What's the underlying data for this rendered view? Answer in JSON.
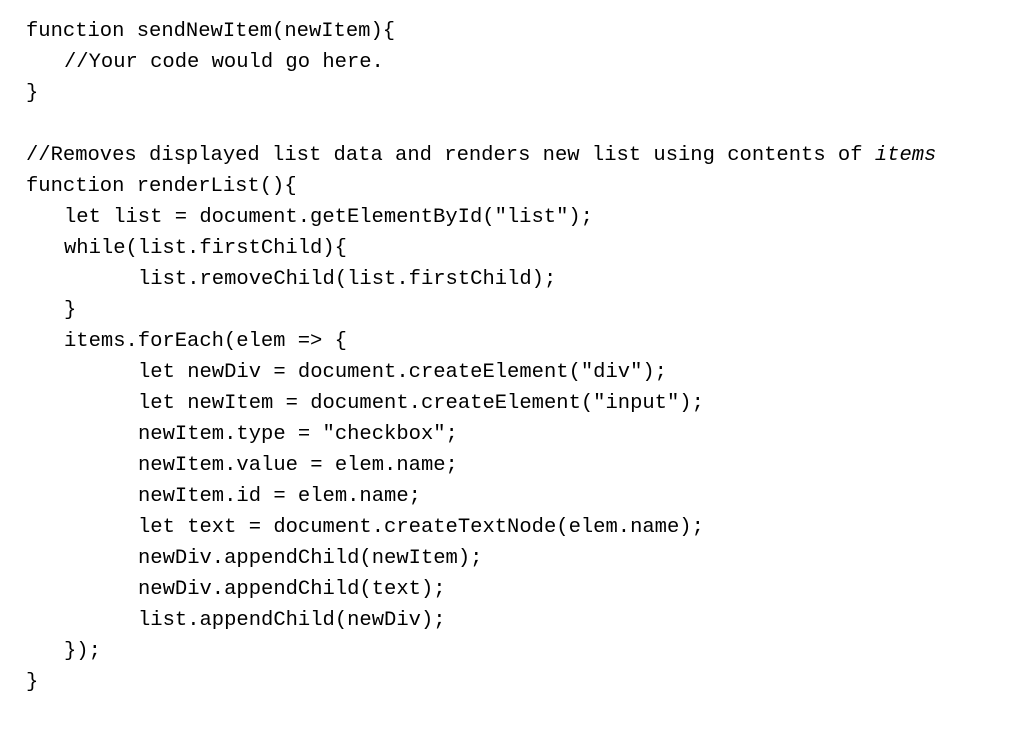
{
  "document": {
    "lines": [
      {
        "indent": 0,
        "text": "function sendNewItem(newItem){"
      },
      {
        "indent": 1,
        "text": "//Your code would go here."
      },
      {
        "indent": 0,
        "text": "}"
      },
      {
        "indent": 0,
        "text": ""
      },
      {
        "indent": 0,
        "text": "//Removes displayed list data and renders new list using contents of ",
        "emphasis": "items"
      },
      {
        "indent": 0,
        "text": "function renderList(){"
      },
      {
        "indent": 1,
        "text": "let list = document.getElementById(\"list\");"
      },
      {
        "indent": 1,
        "text": "while(list.firstChild){"
      },
      {
        "indent": 2,
        "text": "list.removeChild(list.firstChild);"
      },
      {
        "indent": 1,
        "text": "}"
      },
      {
        "indent": 1,
        "text": "items.forEach(elem => {"
      },
      {
        "indent": 2,
        "text": "let newDiv = document.createElement(\"div\");"
      },
      {
        "indent": 2,
        "text": "let newItem = document.createElement(\"input\");"
      },
      {
        "indent": 2,
        "text": "newItem.type = \"checkbox\";"
      },
      {
        "indent": 2,
        "text": "newItem.value = elem.name;"
      },
      {
        "indent": 2,
        "text": "newItem.id = elem.name;"
      },
      {
        "indent": 2,
        "text": "let text = document.createTextNode(elem.name);"
      },
      {
        "indent": 2,
        "text": "newDiv.appendChild(newItem);"
      },
      {
        "indent": 2,
        "text": "newDiv.appendChild(text);"
      },
      {
        "indent": 2,
        "text": "list.appendChild(newDiv);"
      },
      {
        "indent": 1,
        "text": "});"
      },
      {
        "indent": 0,
        "text": "}"
      }
    ]
  }
}
